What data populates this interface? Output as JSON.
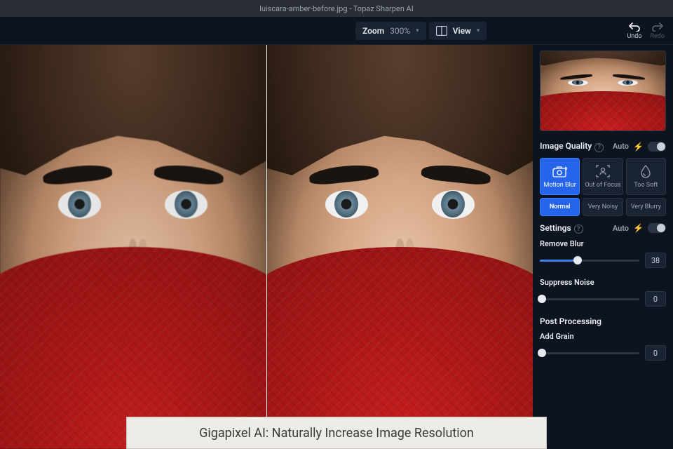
{
  "titlebar": {
    "text": "luiscara-amber-before.jpg - Topaz Sharpen AI"
  },
  "toolbar": {
    "zoom": {
      "label": "Zoom",
      "value": "300%"
    },
    "view": {
      "label": "View"
    },
    "undo": {
      "label": "Undo"
    },
    "redo": {
      "label": "Redo"
    }
  },
  "panel": {
    "image_quality": {
      "title": "Image Quality",
      "auto_label": "Auto",
      "modes": [
        {
          "label": "Motion Blur",
          "active": true
        },
        {
          "label": "Out of Focus",
          "active": false
        },
        {
          "label": "Too Soft",
          "active": false
        }
      ],
      "subs": [
        {
          "label": "Normal",
          "active": true
        },
        {
          "label": "Very Noisy",
          "active": false
        },
        {
          "label": "Very Blurry",
          "active": false
        }
      ]
    },
    "settings": {
      "title": "Settings",
      "auto_label": "Auto",
      "sliders": [
        {
          "label": "Remove Blur",
          "value": 38,
          "pct": 38
        },
        {
          "label": "Suppress Noise",
          "value": 0,
          "pct": 2
        }
      ]
    },
    "post": {
      "title": "Post Processing",
      "sliders": [
        {
          "label": "Add Grain",
          "value": 0,
          "pct": 2
        }
      ]
    }
  },
  "caption": "Gigapixel AI: Naturally Increase Image Resolution"
}
